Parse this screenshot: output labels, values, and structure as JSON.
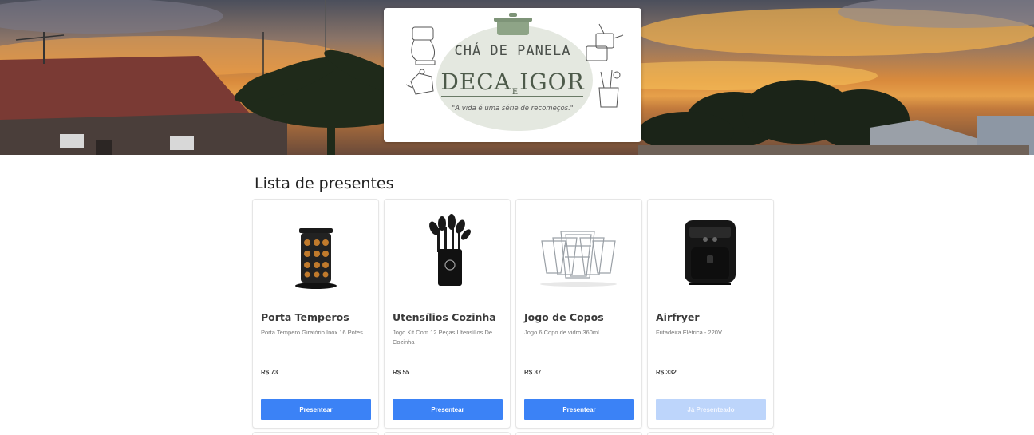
{
  "hero": {
    "logo": {
      "title": "CHÁ DE PANELA",
      "name_left": "DECA",
      "conjunction": "E",
      "name_right": "IGOR",
      "quote": "\"A vida é uma série de recomeços.\""
    }
  },
  "gifts": {
    "title": "Lista de presentes",
    "items": [
      {
        "name": "Porta Temperos",
        "description": "Porta Tempero Giratório Inox 16 Potes",
        "price": "R$ 73",
        "button": "Presentear",
        "image_icon": "spice-rack-icon",
        "gifted": false
      },
      {
        "name": "Utensílios Cozinha",
        "description": "Jogo Kit Com 12 Peças Utensílios De Cozinha",
        "price": "R$ 55",
        "button": "Presentear",
        "image_icon": "kitchen-utensils-icon",
        "gifted": false
      },
      {
        "name": "Jogo de Copos",
        "description": "Jogo 6 Copo de vidro 360ml",
        "price": "R$ 37",
        "button": "Presentear",
        "image_icon": "glasses-icon",
        "gifted": false
      },
      {
        "name": "Airfryer",
        "description": "Fritadeira Elétrica - 220V",
        "price": "R$ 332",
        "button": "Já Presenteado",
        "image_icon": "airfryer-icon",
        "gifted": true
      }
    ]
  },
  "colors": {
    "primary_button": "#3b82f6",
    "disabled_button": "#bdd5fb"
  }
}
